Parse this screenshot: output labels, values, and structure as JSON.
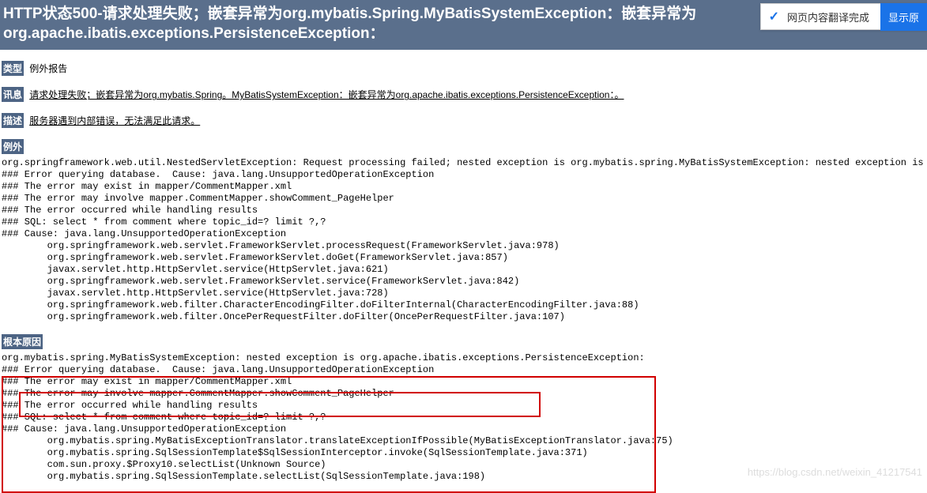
{
  "header": {
    "title": "HTTP状态500-请求处理失败；嵌套异常为org.mybatis.Spring.MyBatisSystemException：嵌套异常为org.apache.ibatis.exceptions.PersistenceException："
  },
  "translate_bar": {
    "message": "网页内容翻译完成",
    "button": "显示原"
  },
  "sections": {
    "type_label": "类型",
    "type_text": "例外报告",
    "message_label": "讯息",
    "message_text": "请求处理失败；嵌套异常为org.mybatis.Spring。MyBatisSystemException：嵌套异常为org.apache.ibatis.exceptions.PersistenceException：。",
    "description_label": "描述",
    "description_text": "服务器遇到内部错误，无法满足此请求。",
    "exception_label": "例外",
    "root_cause_label": "根本原因"
  },
  "stacktrace1": "org.springframework.web.util.NestedServletException: Request processing failed; nested exception is org.mybatis.spring.MyBatisSystemException: nested exception is org.apache.ibatis.exceptions.PersistenceException:\n### Error querying database.  Cause: java.lang.UnsupportedOperationException\n### The error may exist in mapper/CommentMapper.xml\n### The error may involve mapper.CommentMapper.showComment_PageHelper\n### The error occurred while handling results\n### SQL: select * from comment where topic_id=? limit ?,?\n### Cause: java.lang.UnsupportedOperationException\n\torg.springframework.web.servlet.FrameworkServlet.processRequest(FrameworkServlet.java:978)\n\torg.springframework.web.servlet.FrameworkServlet.doGet(FrameworkServlet.java:857)\n\tjavax.servlet.http.HttpServlet.service(HttpServlet.java:621)\n\torg.springframework.web.servlet.FrameworkServlet.service(FrameworkServlet.java:842)\n\tjavax.servlet.http.HttpServlet.service(HttpServlet.java:728)\n\torg.springframework.web.filter.CharacterEncodingFilter.doFilterInternal(CharacterEncodingFilter.java:88)\n\torg.springframework.web.filter.OncePerRequestFilter.doFilter(OncePerRequestFilter.java:107)",
  "stacktrace2": "org.mybatis.spring.MyBatisSystemException: nested exception is org.apache.ibatis.exceptions.PersistenceException:\n### Error querying database.  Cause: java.lang.UnsupportedOperationException\n### The error may exist in mapper/CommentMapper.xml\n### The error may involve mapper.CommentMapper.showComment_PageHelper\n### The error occurred while handling results\n### SQL: select * from comment where topic_id=? limit ?,?\n### Cause: java.lang.UnsupportedOperationException\n\torg.mybatis.spring.MyBatisExceptionTranslator.translateExceptionIfPossible(MyBatisExceptionTranslator.java:75)\n\torg.mybatis.spring.SqlSessionTemplate$SqlSessionInterceptor.invoke(SqlSessionTemplate.java:371)\n\tcom.sun.proxy.$Proxy10.selectList(Unknown Source)\n\torg.mybatis.spring.SqlSessionTemplate.selectList(SqlSessionTemplate.java:198)",
  "watermark": "https://blog.csdn.net/weixin_41217541"
}
